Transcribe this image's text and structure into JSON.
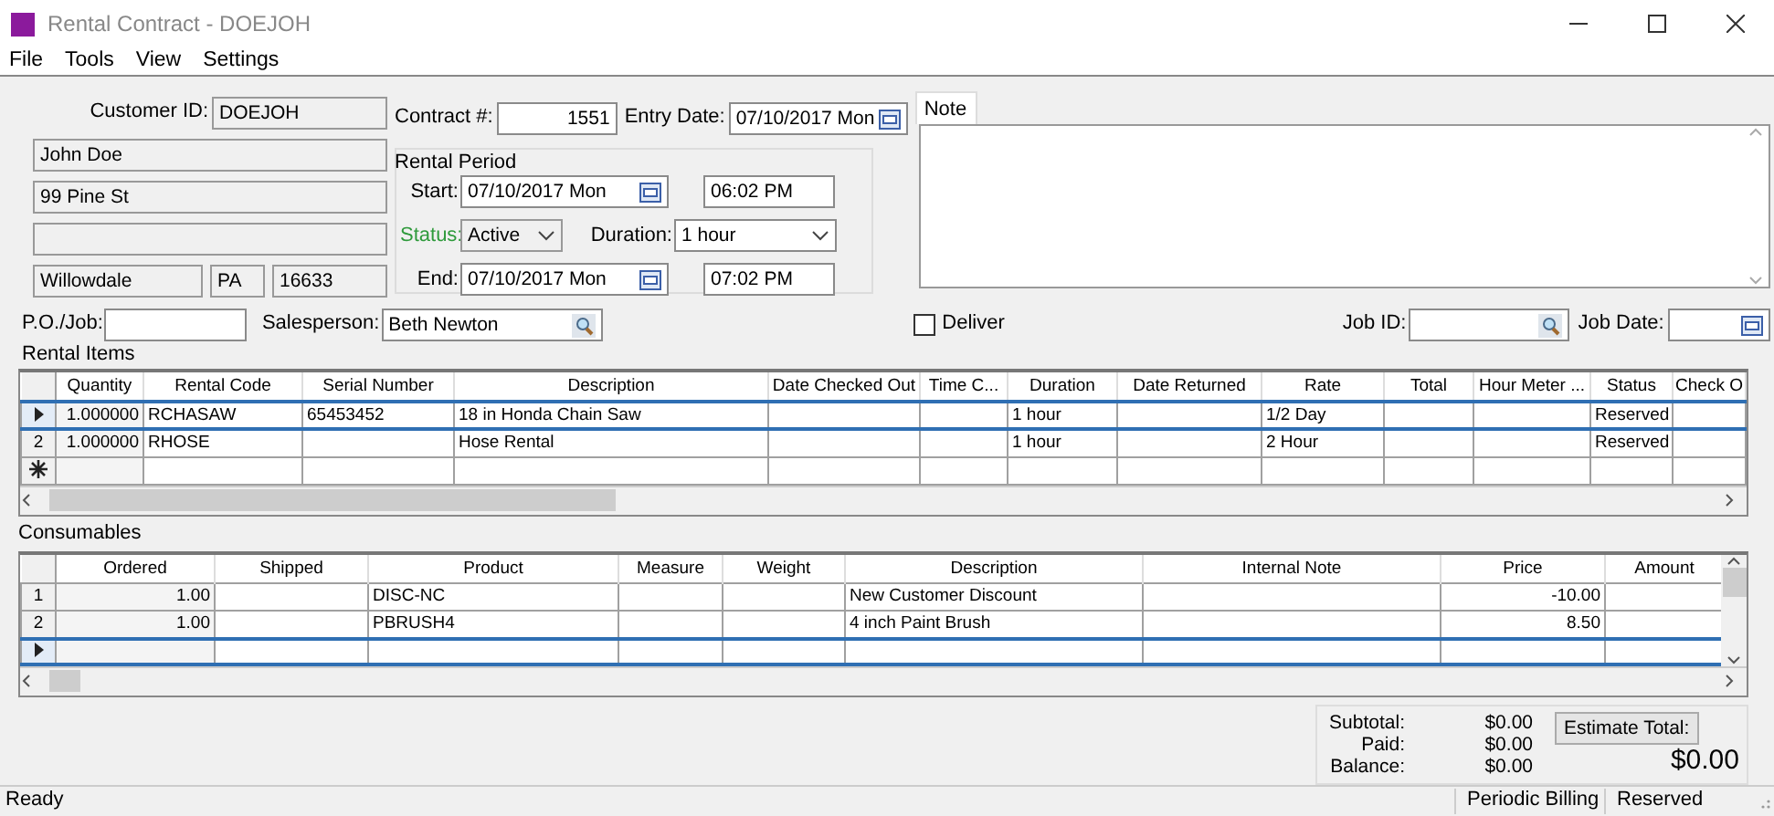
{
  "window": {
    "title": "Rental Contract - DOEJOH"
  },
  "menu": [
    "File",
    "Tools",
    "View",
    "Settings"
  ],
  "customer": {
    "label": "Customer ID:",
    "id": "DOEJOH",
    "name": "John Doe",
    "street": "99 Pine St",
    "city": "Willowdale",
    "state": "PA",
    "zip": "16633"
  },
  "contract": {
    "label": "Contract #:",
    "number": "1551",
    "entry_date_label": "Entry Date:",
    "entry_date": "07/10/2017 Mon"
  },
  "rental_period": {
    "title": "Rental Period",
    "start_label": "Start:",
    "start_date": "07/10/2017 Mon",
    "start_time": "06:02 PM",
    "status_label": "Status:",
    "status": "Active",
    "duration_label": "Duration:",
    "duration": "1 hour",
    "end_label": "End:",
    "end_date": "07/10/2017 Mon",
    "end_time": "07:02 PM"
  },
  "note": {
    "tab": "Note"
  },
  "po_job": {
    "label": "P.O./Job:"
  },
  "salesperson": {
    "label": "Salesperson:",
    "value": "Beth Newton"
  },
  "deliver": {
    "label": "Deliver",
    "checked": false
  },
  "job_id": {
    "label": "Job ID:"
  },
  "job_date": {
    "label": "Job Date:"
  },
  "rental_items": {
    "title": "Rental Items",
    "columns": [
      {
        "label": "Quantity",
        "numeric": true
      },
      {
        "label": "Rental Code",
        "numeric": false
      },
      {
        "label": "Serial Number",
        "numeric": false
      },
      {
        "label": "Description",
        "numeric": false
      },
      {
        "label": "Date Checked Out",
        "numeric": false
      },
      {
        "label": "Time C...",
        "numeric": false
      },
      {
        "label": "Duration",
        "numeric": false
      },
      {
        "label": "Date Returned",
        "numeric": false
      },
      {
        "label": "Rate",
        "numeric": false
      },
      {
        "label": "Total",
        "numeric": false
      },
      {
        "label": "Hour Meter ...",
        "numeric": false
      },
      {
        "label": "Status",
        "numeric": false
      },
      {
        "label": "Check O",
        "numeric": false
      }
    ],
    "rows": [
      {
        "kind": "current",
        "selected": true,
        "cells": [
          "1.000000",
          "RCHASAW",
          "65453452",
          "18 in Honda Chain Saw",
          "",
          "",
          "1 hour",
          "",
          "1/2 Day",
          "",
          "",
          "Reserved",
          ""
        ]
      },
      {
        "kind": "numbered",
        "header": "2",
        "selected": false,
        "cells": [
          "1.000000",
          "RHOSE",
          "",
          "Hose Rental",
          "",
          "",
          "1 hour",
          "",
          "2 Hour",
          "",
          "",
          "Reserved",
          ""
        ]
      },
      {
        "kind": "new",
        "selected": false,
        "cells": [
          "",
          "",
          "",
          "",
          "",
          "",
          "",
          "",
          "",
          "",
          "",
          "",
          ""
        ]
      }
    ]
  },
  "consumables": {
    "title": "Consumables",
    "columns": [
      {
        "label": "Ordered",
        "numeric": true
      },
      {
        "label": "Shipped",
        "numeric": false
      },
      {
        "label": "Product",
        "numeric": false
      },
      {
        "label": "Measure",
        "numeric": false
      },
      {
        "label": "Weight",
        "numeric": false
      },
      {
        "label": "Description",
        "numeric": false
      },
      {
        "label": "Internal Note",
        "numeric": false
      },
      {
        "label": "Price",
        "numeric": true
      },
      {
        "label": "Amount",
        "numeric": true
      }
    ],
    "rows": [
      {
        "kind": "numbered",
        "header": "1",
        "selected": false,
        "cells": [
          "1.00",
          "",
          "DISC-NC",
          "",
          "",
          "New Customer Discount",
          "",
          "-10.00",
          ""
        ]
      },
      {
        "kind": "numbered",
        "header": "2",
        "selected": false,
        "cells": [
          "1.00",
          "",
          "PBRUSH4",
          "",
          "",
          "4 inch Paint Brush",
          "",
          "8.50",
          ""
        ]
      },
      {
        "kind": "current",
        "selected": true,
        "cells": [
          "",
          "",
          "",
          "",
          "",
          "",
          "",
          "",
          ""
        ]
      }
    ]
  },
  "totals": {
    "rows": [
      {
        "label": "Subtotal:",
        "value": "$0.00"
      },
      {
        "label": "Paid:",
        "value": "$0.00"
      },
      {
        "label": "Balance:",
        "value": "$0.00"
      }
    ],
    "button": "Estimate Total:",
    "total": "$0.00"
  },
  "status_bar": [
    "Ready",
    "Periodic Billing",
    "Reserved"
  ]
}
